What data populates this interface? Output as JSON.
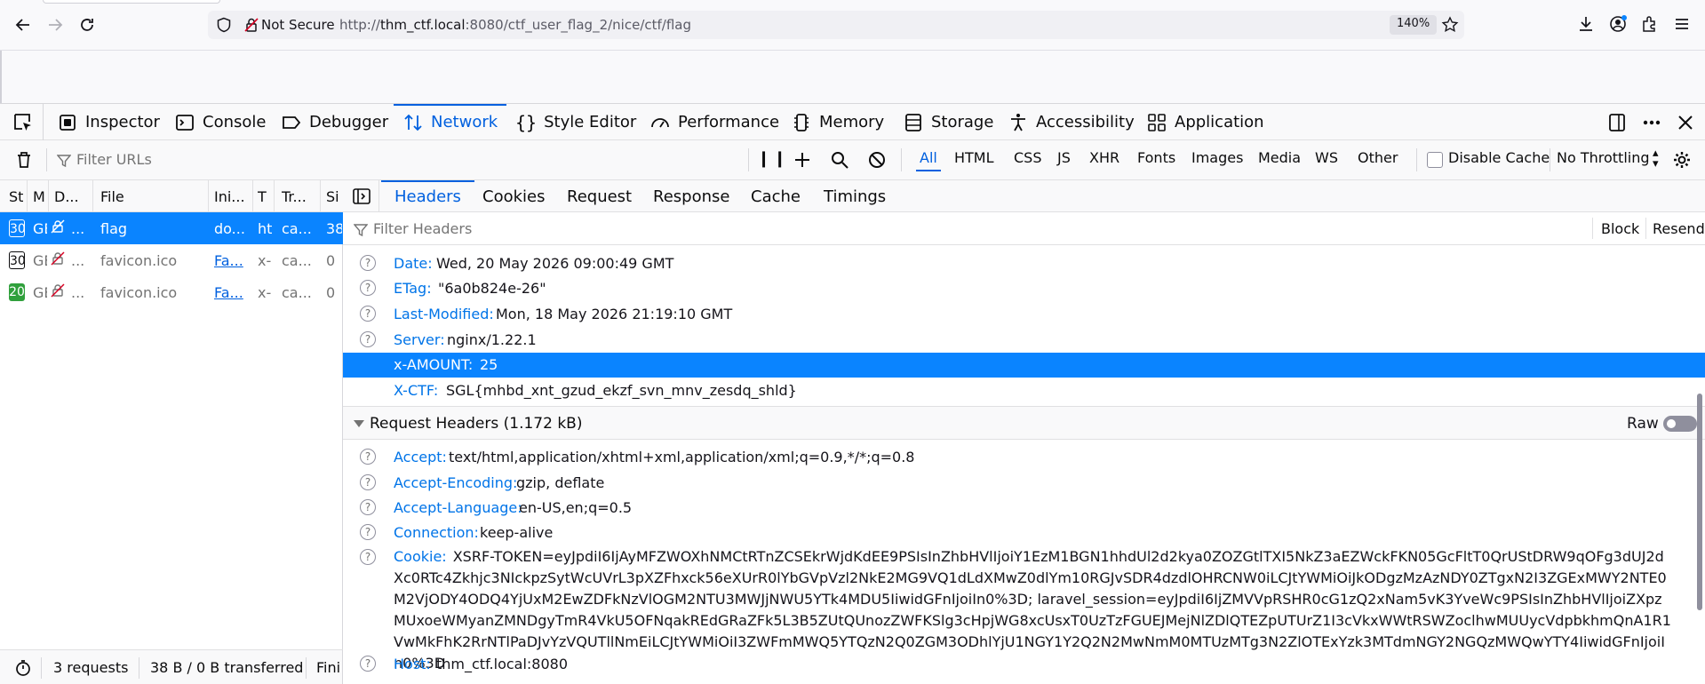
{
  "urlbar": {
    "not_secure_label": "Not Secure",
    "url_scheme": "http://",
    "url_host": "thm_ctf.local",
    "url_rest": ":8080/ctf_user_flag_2/nice/ctf/flag",
    "zoom": "140%"
  },
  "devtools": {
    "tabs": [
      {
        "label": "Inspector",
        "icon": "inspector-icon"
      },
      {
        "label": "Console",
        "icon": "console-icon"
      },
      {
        "label": "Debugger",
        "icon": "debugger-icon"
      },
      {
        "label": "Network",
        "icon": "network-icon",
        "selected": true
      },
      {
        "label": "Style Editor",
        "icon": "style-editor-icon"
      },
      {
        "label": "Performance",
        "icon": "performance-icon"
      },
      {
        "label": "Memory",
        "icon": "memory-icon"
      },
      {
        "label": "Storage",
        "icon": "storage-icon"
      },
      {
        "label": "Accessibility",
        "icon": "accessibility-icon"
      },
      {
        "label": "Application",
        "icon": "application-icon"
      }
    ]
  },
  "network": {
    "filter_placeholder": "Filter URLs",
    "type_filters": [
      "All",
      "HTML",
      "CSS",
      "JS",
      "XHR",
      "Fonts",
      "Images",
      "Media",
      "WS",
      "Other"
    ],
    "active_type": "All",
    "disable_cache_label": "Disable Cache",
    "throttling": "No Throttling",
    "columns": [
      "St",
      "M",
      "D...",
      "File",
      "Ini...",
      "T",
      "Tr...",
      "Si"
    ],
    "rows": [
      {
        "status": "30",
        "method": "GE",
        "domain": "...",
        "file": "flag",
        "initiator": "do...",
        "type": "ht",
        "transferred": "ca...",
        "size": "38",
        "selected": true,
        "badge_color": "#0a84ff"
      },
      {
        "status": "30",
        "method": "GE",
        "domain": "...",
        "file": "favicon.ico",
        "initiator": "Fa...",
        "type": "x-i",
        "transferred": "ca...",
        "size": "0",
        "selected": false,
        "badge_color": "#ffffff"
      },
      {
        "status": "20",
        "method": "GE",
        "domain": "...",
        "file": "favicon.ico",
        "initiator": "Fa...",
        "type": "x-i",
        "transferred": "ca...",
        "size": "0",
        "selected": false,
        "badge_color": "#30a03c"
      }
    ],
    "footer": {
      "requests": "3 requests",
      "transferred": "38 B / 0 B transferred",
      "finish": "Fini"
    }
  },
  "details": {
    "tabs": [
      "Headers",
      "Cookies",
      "Request",
      "Response",
      "Cache",
      "Timings"
    ],
    "selected_tab": "Headers",
    "filter_placeholder": "Filter Headers",
    "block_label": "Block",
    "resend_label": "Resend",
    "response_headers": [
      {
        "name": "Date:",
        "value": "Wed, 20 May 2026 09:00:49 GMT"
      },
      {
        "name": "ETag:",
        "value": "\"6a0b824e-26\""
      },
      {
        "name": "Last-Modified:",
        "value": "Mon, 18 May 2026 21:19:10 GMT"
      },
      {
        "name": "Server:",
        "value": "nginx/1.22.1"
      },
      {
        "name": "x-AMOUNT:",
        "value": "25",
        "highlight": true
      },
      {
        "name": "X-CTF:",
        "value": "SGL{mhbd_xnt_gzud_ekzf_svn_mnv_zesdq_shld}"
      }
    ],
    "request_headers_title": "Request Headers (1.172 kB)",
    "raw_label": "Raw",
    "request_headers": [
      {
        "name": "Accept:",
        "value": "text/html,application/xhtml+xml,application/xml;q=0.9,*/*;q=0.8"
      },
      {
        "name": "Accept-Encoding:",
        "value": "gzip, deflate"
      },
      {
        "name": "Accept-Language:",
        "value": "en-US,en;q=0.5"
      },
      {
        "name": "Connection:",
        "value": "keep-alive"
      }
    ],
    "cookie": {
      "name": "Cookie:",
      "value": "XSRF-TOKEN=eyJpdiI6IjAyMFZWOXhNMCtRTnZCSEkrWjdKdEE9PSIsInZhbHVlIjoiY1EzM1BGN1hhdUl2d2kya0ZOZGtlTXI5NkZ3aEZWckFKN05GcFltT0QrUStDRW9qOFg3dUJ2dXc0RTc4Zkhjc3NIckpzSytWcUVrL3pXZFhxck56eXUrR0lYbGVpVzl2NkE2MG9VQ1dLdXMwZ0dlYm10RGJvSDR4dzdlOHRCNW0iLCJtYWMiOiJkODgzMzAzNDY0ZTgxN2I3ZGExMWY2NTE0M2VjODY4ODQ4YjUxM2EwZDFkNzVlOGM2NTU3MWJjNWU5YTk4MDU5IiwidGFnIjoiIn0%3D; laravel_session=eyJpdiI6IjZMVVpRSHR0cG1zQ2xNam5vK3YveWc9PSIsInZhbHVlIjoiZXpzMUxoeWMyanZMNDgyTmR4VkU5OFNqakREdGRaZFk5L3B5ZUtQUnozZWFKSlg3cHpjWG8xcUsxT0UzTzFGUEJMejNlZDlQTEZpUTUrZ1I3cVkxWWtRSWZoclhwMUUycVdpbkhmQnA1R1VwMkFhK2RrNTlPaDJvYzVQUTllNmEiLCJtYWMiOiI3ZWFmMWQ5YTQzN2Q0ZGM3ODhlYjU1NGY1Y2Q2N2MwNmM0MTUzMTg3N2ZlOTExYzk3MTdmNGY2NGQzMWQwYTY4IiwidGFnIjoiIn0%3D"
    },
    "host": {
      "name": "Host:",
      "value": "thm_ctf.local:8080"
    }
  }
}
